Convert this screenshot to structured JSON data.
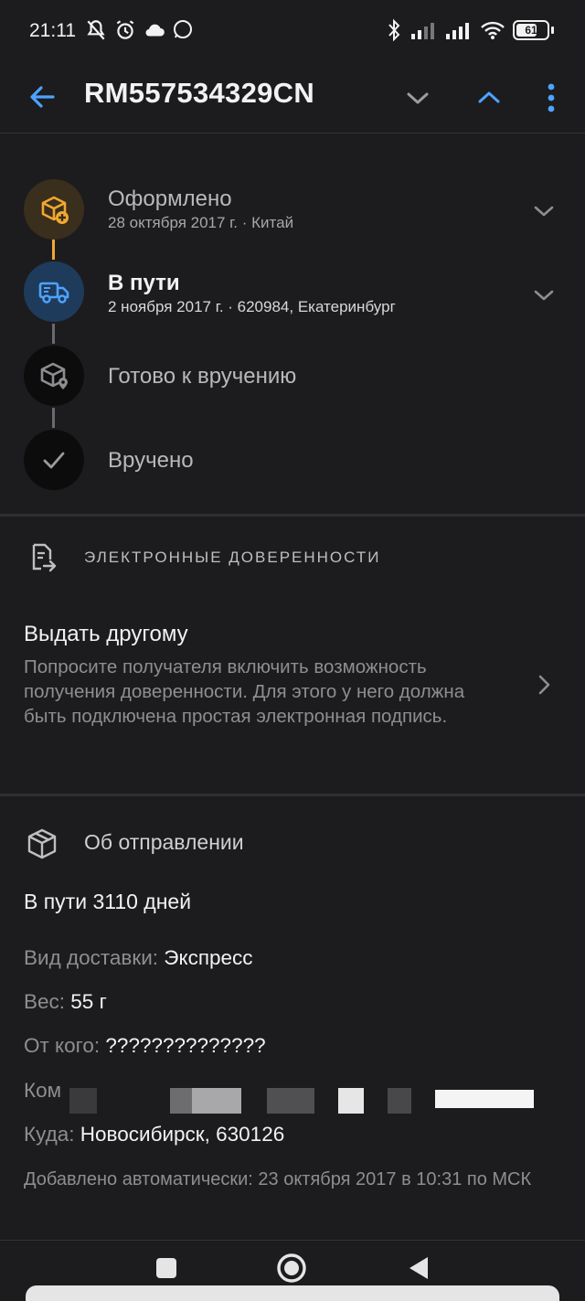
{
  "status_bar": {
    "time": "21:11",
    "battery": "61"
  },
  "app_bar": {
    "title": "RM557534329CN"
  },
  "timeline": {
    "steps": [
      {
        "title": "Оформлено",
        "subtitle": "28 октября 2017 г. · Китай",
        "state": "done",
        "icon": "package-add-icon"
      },
      {
        "title": "В пути",
        "subtitle": "2 ноября 2017 г. · 620984, Екатеринбург",
        "state": "current",
        "icon": "truck-icon"
      },
      {
        "title": "Готово к вручению",
        "subtitle": "",
        "state": "pending",
        "icon": "package-pin-icon"
      },
      {
        "title": "Вручено",
        "subtitle": "",
        "state": "pending",
        "icon": "check-icon"
      }
    ]
  },
  "proxy_section": {
    "header": "ЭЛЕКТРОННЫЕ ДОВЕРЕННОСТИ",
    "item_title": "Выдать другому",
    "item_desc": "Попросите получателя включить возможность получения доверенности. Для этого у него должна быть подключена простая электронная подпись."
  },
  "shipment_section": {
    "header": "Об отправлении",
    "days_in_transit": "В пути 3110 дней",
    "delivery_label": "Вид доставки:",
    "delivery_value": "Экспресс",
    "weight_label": "Вес:",
    "weight_value": "55 г",
    "from_label": "От кого:",
    "from_value": "??????????????",
    "to_whom_label": "Ком",
    "to_label": "Куда:",
    "to_value": "Новосибирск, 630126",
    "added_text": "Добавлено автоматически: 23 октября 2017 в 10:31 по МСК"
  },
  "colors": {
    "background": "#1c1c1e",
    "accent_blue": "#4da3ff",
    "accent_orange": "#f0a830",
    "text_primary": "#f2f2f2",
    "text_secondary": "#8e8e92"
  }
}
